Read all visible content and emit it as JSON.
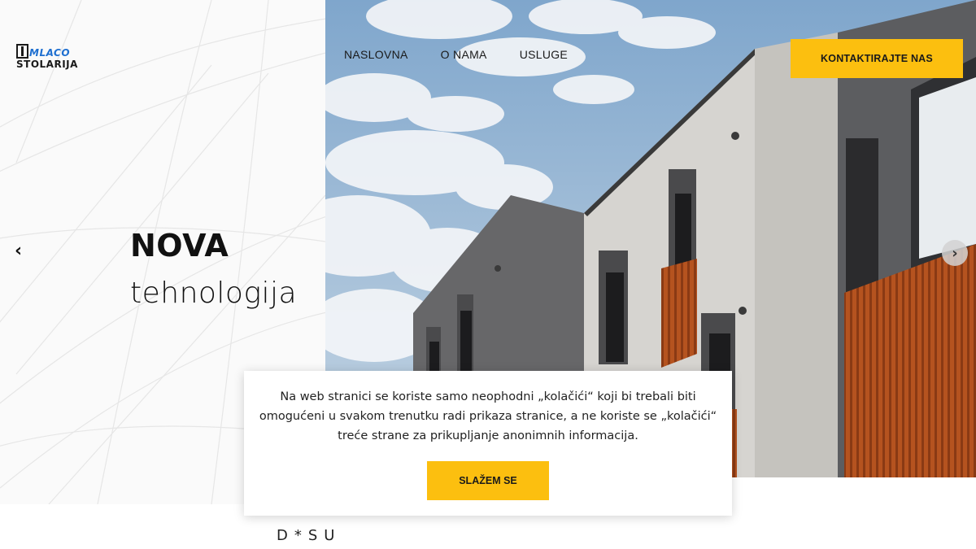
{
  "logo": {
    "top": "MLACO",
    "bottom": "STOLARIJA"
  },
  "nav": {
    "items": [
      "NASLOVNA",
      "O NAMA",
      "USLUGE"
    ]
  },
  "header": {
    "cta_label": "KONTAKTIRAJTE NAS"
  },
  "hero": {
    "title": "NOVA",
    "subtitle": "tehnologija",
    "prev_icon": "‹",
    "next_icon": "›"
  },
  "cookie": {
    "message": "Na web stranici se koriste samo neophodni „kolačići“ koji bi trebali biti omogućeni u svakom trenutku radi prikaza stranice, a ne koriste se „kolačići“ treće strane za prikupljanje anonimnih informacija.",
    "agree_label": "SLAŽEM SE"
  },
  "bottom": {
    "partial_text": "D*SU"
  },
  "colors": {
    "accent": "#fcbf0f",
    "logo_blue": "#1e6fd0",
    "text": "#1a1a1a"
  }
}
